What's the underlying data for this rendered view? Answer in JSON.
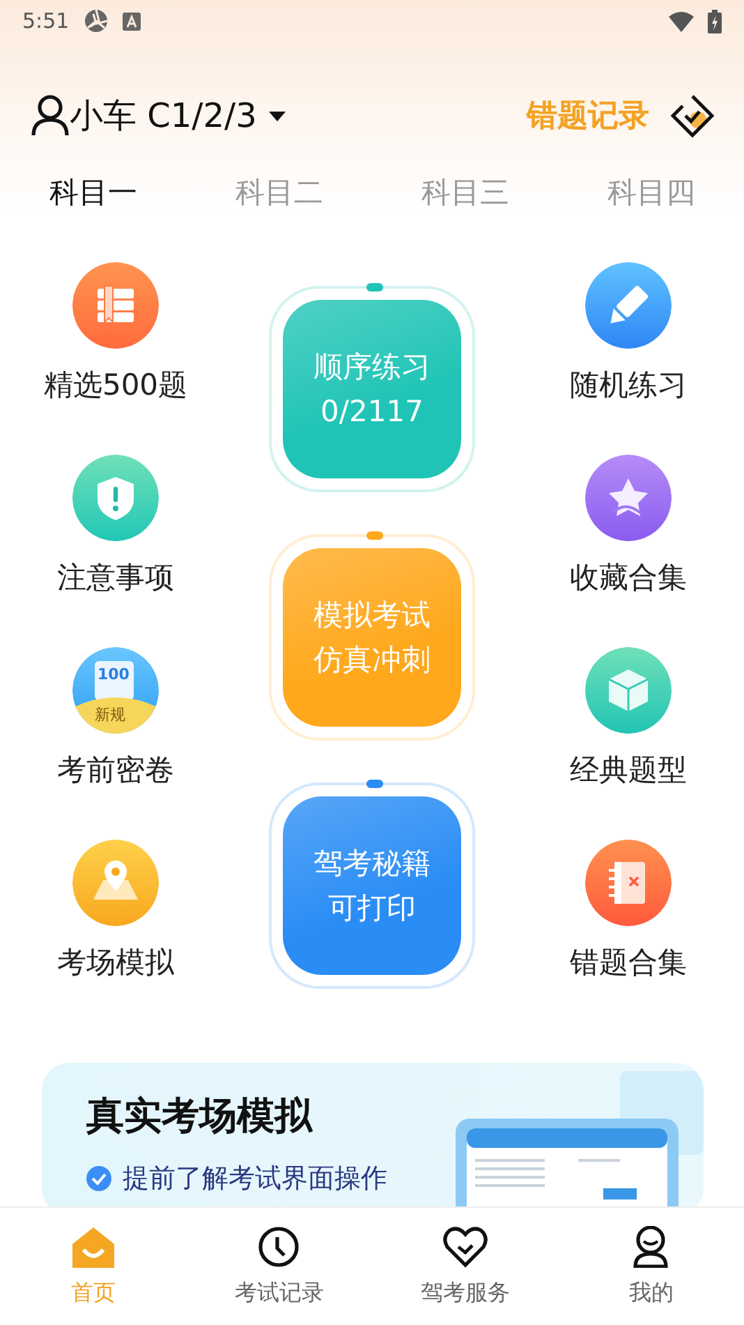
{
  "status_bar": {
    "time": "5:51"
  },
  "header": {
    "user_label": "小车 C1/2/3",
    "wrong_record": "错题记录"
  },
  "tabs": [
    {
      "label": "科目一",
      "selected": true
    },
    {
      "label": "科目二",
      "selected": false
    },
    {
      "label": "科目三",
      "selected": false
    },
    {
      "label": "科目四",
      "selected": false
    }
  ],
  "left_features": [
    {
      "label": "精选500题"
    },
    {
      "label": "注意事项"
    },
    {
      "label": "考前密卷",
      "icon_text": "100",
      "badge": "新规"
    },
    {
      "label": "考场模拟"
    }
  ],
  "center_cards": [
    {
      "lines": [
        "顺序练习",
        "0/2117"
      ],
      "color": "#1fc4b6"
    },
    {
      "lines": [
        "模拟考试",
        "仿真冲刺"
      ],
      "color": "#ffa81c"
    },
    {
      "lines": [
        "驾考秘籍",
        "可打印"
      ],
      "color": "#2a8df5"
    }
  ],
  "right_features": [
    {
      "label": "随机练习"
    },
    {
      "label": "收藏合集"
    },
    {
      "label": "经典题型"
    },
    {
      "label": "错题合集"
    }
  ],
  "banner": {
    "title": "真实考场模拟",
    "point": "提前了解考试界面操作"
  },
  "bottom_nav": [
    {
      "label": "首页",
      "selected": true
    },
    {
      "label": "考试记录",
      "selected": false
    },
    {
      "label": "驾考服务",
      "selected": false
    },
    {
      "label": "我的",
      "selected": false
    }
  ]
}
